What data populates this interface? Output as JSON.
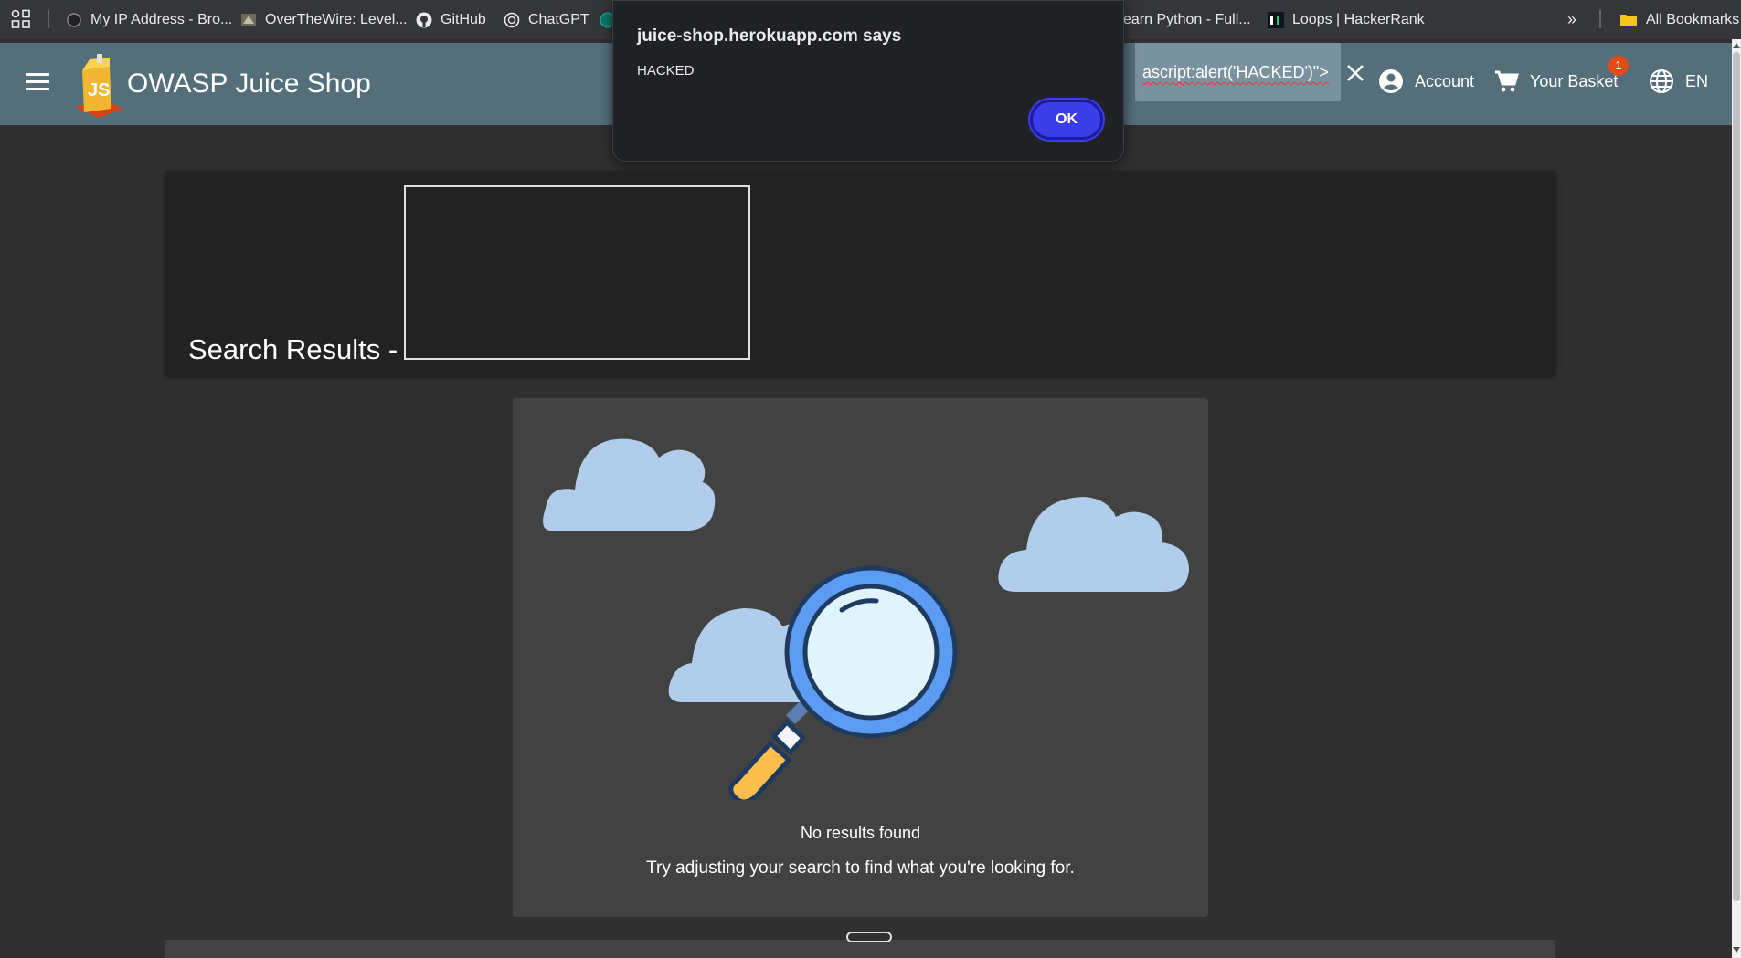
{
  "bookmarks": {
    "items": [
      {
        "label": "My IP Address - Bro...",
        "icon": "globe-icon"
      },
      {
        "label": "OverTheWire: Level...",
        "icon": "otw-icon"
      },
      {
        "label": "GitHub",
        "icon": "github-icon"
      },
      {
        "label": "ChatGPT",
        "icon": "chatgpt-icon"
      },
      {
        "label": "earn Python - Full...",
        "icon": ""
      },
      {
        "label": "Loops | HackerRank",
        "icon": "hackerrank-icon"
      }
    ],
    "all_bookmarks": "All Bookmarks"
  },
  "toolbar": {
    "title": "OWASP Juice Shop",
    "search_value": "ascript:alert('HACKED')\">",
    "account_label": "Account",
    "basket_label": "Your Basket",
    "basket_count": "1",
    "language": "EN"
  },
  "dialog": {
    "title": "juice-shop.herokuapp.com says",
    "message": "HACKED",
    "ok_label": "OK"
  },
  "main": {
    "results_label": "Search Results -",
    "no_results": "No results found",
    "hint": "Try adjusting your search to find what you're looking for."
  },
  "colors": {
    "toolbar": "#546e7a",
    "background": "#303030",
    "card": "#424242",
    "cloud": "#b0cdec",
    "ok_button": "#3b3de8"
  }
}
